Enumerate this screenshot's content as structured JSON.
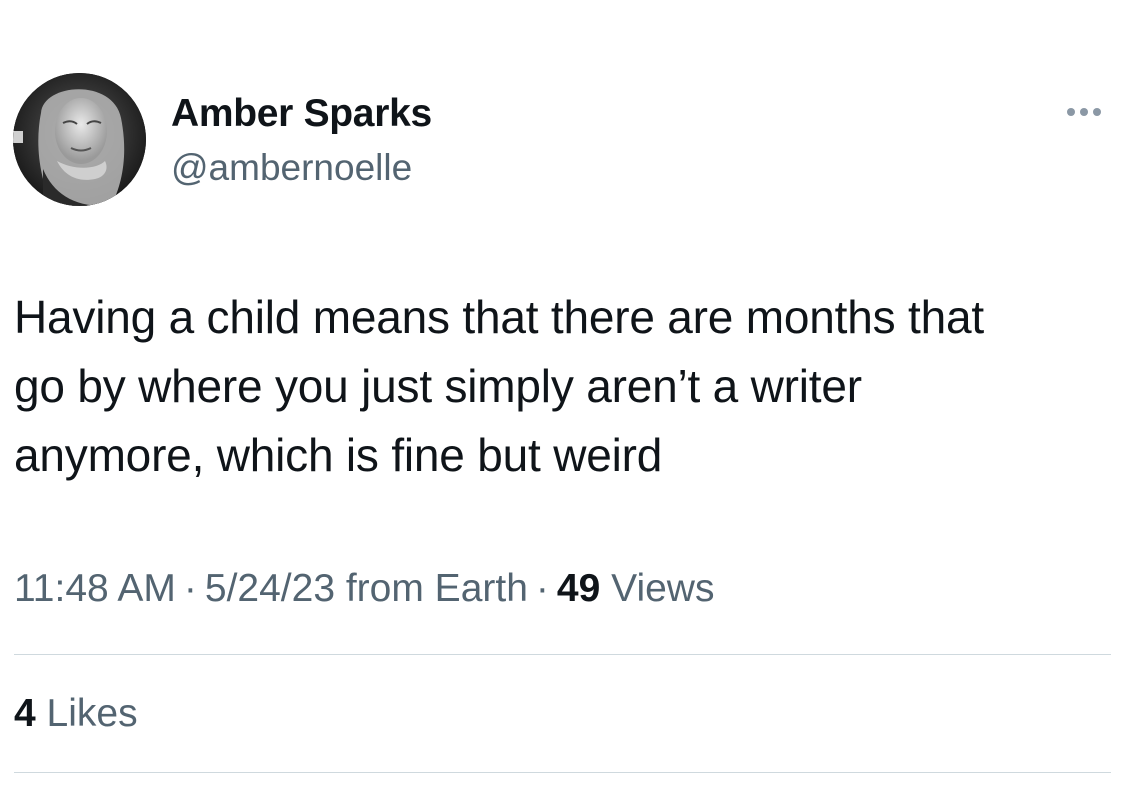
{
  "author": {
    "display_name": "Amber Sparks",
    "handle": "@ambernoelle"
  },
  "tweet": {
    "text_lines": [
      "Having a child means that there are months that",
      "go by where you just simply aren’t a writer",
      "anymore, which is fine but weird"
    ],
    "time": "11:48 AM",
    "date": "5/24/23 from Earth",
    "separator": "·",
    "views_count": "49",
    "views_label": "Views",
    "likes_count": "4",
    "likes_label": "Likes"
  },
  "icons": {
    "more": "more-horizontal-icon"
  },
  "colors": {
    "primary_text": "#0f1419",
    "secondary_text": "#536471",
    "divider": "#cfd9de"
  }
}
